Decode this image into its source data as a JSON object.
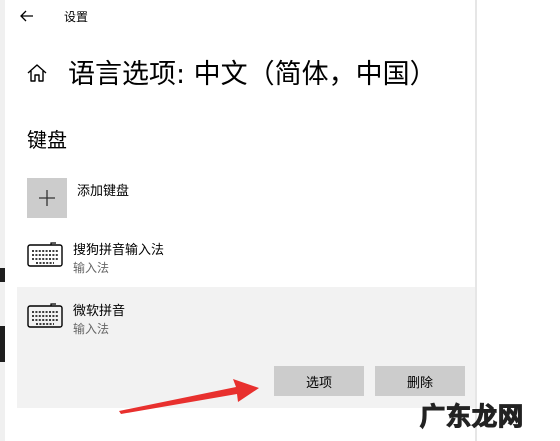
{
  "window": {
    "title": "设置"
  },
  "header": {
    "title": "语言选项: 中文（简体，中国）"
  },
  "keyboard_section": {
    "title": "键盘",
    "add_label": "添加键盘",
    "items": [
      {
        "name": "搜狗拼音输入法",
        "type": "输入法"
      },
      {
        "name": "微软拼音",
        "type": "输入法",
        "selected": true
      }
    ],
    "options_button": "选项",
    "remove_button": "删除"
  },
  "annotation": {
    "arrow_color": "#e8302e"
  },
  "watermark": {
    "text": "广东龙网"
  }
}
